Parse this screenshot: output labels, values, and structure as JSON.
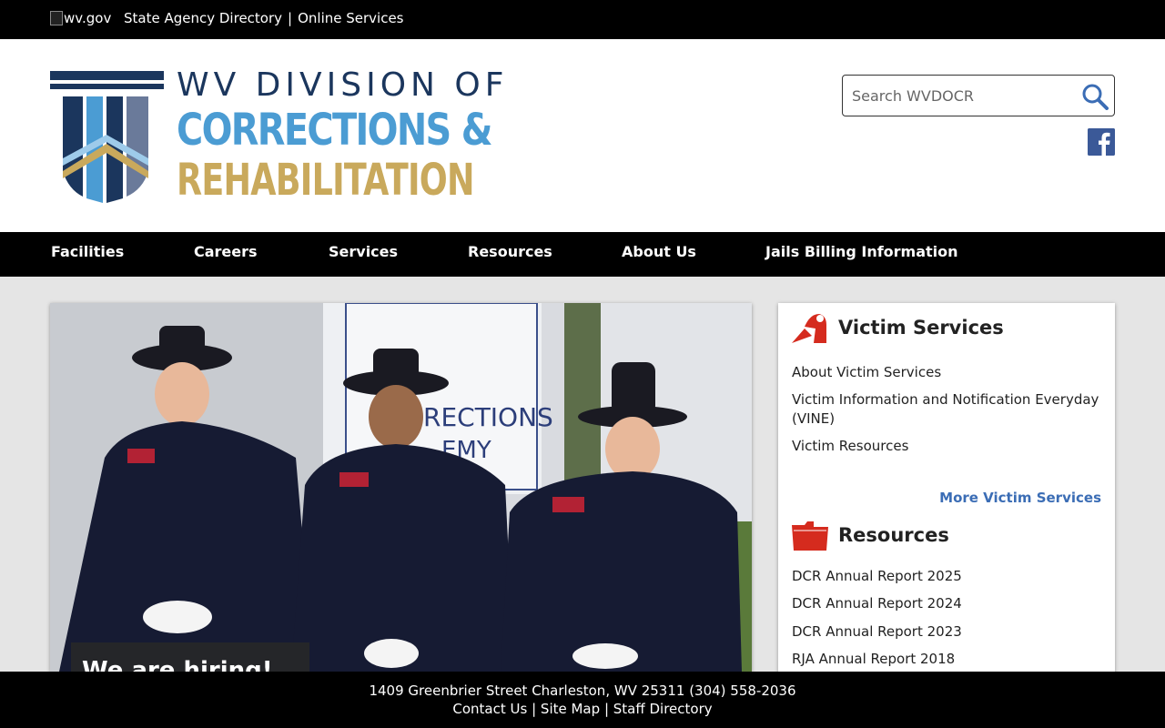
{
  "topbar": {
    "wvgov_alt": "wv.gov",
    "links": [
      "State Agency Directory",
      "|",
      "Online Services"
    ]
  },
  "logo": {
    "line1": "WV DIVISION OF",
    "line2": "CORRECTIONS &",
    "line3": "REHABILITATION"
  },
  "search": {
    "placeholder": "Search WVDOCR"
  },
  "nav": {
    "items": [
      "Facilities",
      "Careers",
      "Services",
      "Resources",
      "About Us",
      "Jails Billing Information"
    ]
  },
  "hero": {
    "caption": "We are hiring!"
  },
  "victim_services": {
    "title": "Victim Services",
    "links": [
      "About Victim Services",
      "Victim Information and Notification Everyday (VINE)",
      "Victim Resources"
    ],
    "more": "More Victim Services"
  },
  "resources": {
    "title": "Resources",
    "links": [
      "DCR Annual Report 2025",
      "DCR Annual Report 2024",
      "DCR Annual Report 2023",
      "RJA Annual Report 2018"
    ]
  },
  "footer": {
    "address": "1409 Greenbrier Street Charleston, WV 25311 (304) 558-2036",
    "links": [
      "Contact Us",
      "|",
      "Site Map",
      "|",
      "Staff Directory"
    ]
  },
  "colors": {
    "navy": "#1b365d",
    "blue": "#4b9cd3",
    "gold": "#c9a95c",
    "link_blue": "#3b6db5",
    "icon_red": "#d52b1e"
  }
}
